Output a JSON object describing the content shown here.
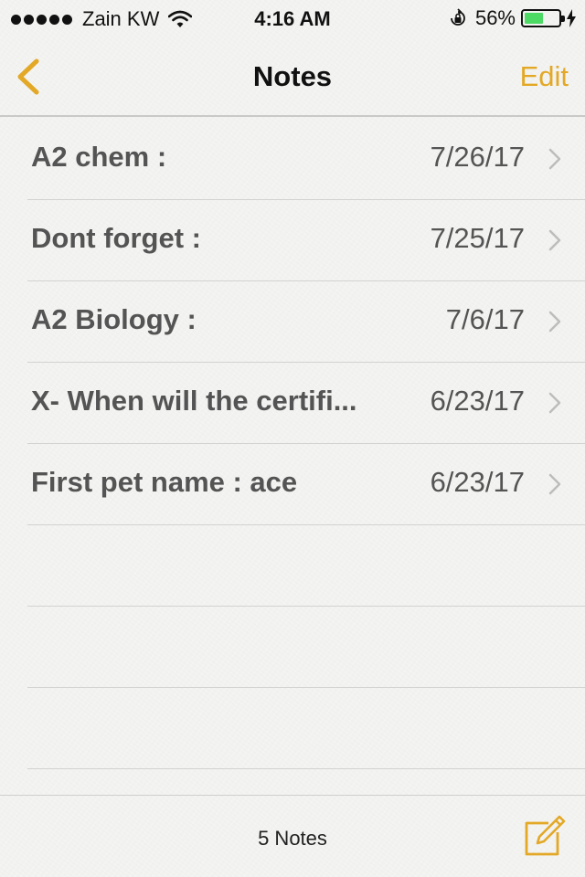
{
  "status_bar": {
    "carrier": "Zain KW",
    "time": "4:16 AM",
    "battery_percent": "56%",
    "battery_level": 0.56,
    "signal_dots": 5,
    "icons": [
      "wifi-icon",
      "rotation-lock-icon",
      "battery-icon",
      "charging-bolt-icon"
    ]
  },
  "nav": {
    "title": "Notes",
    "edit_label": "Edit",
    "back_icon": "chevron-left-icon"
  },
  "notes": [
    {
      "title": "A2 chem :",
      "date": "7/26/17"
    },
    {
      "title": "Dont forget :",
      "date": "7/25/17"
    },
    {
      "title": "A2 Biology :",
      "date": "7/6/17"
    },
    {
      "title": "X- When will the certifi...",
      "date": "6/23/17"
    },
    {
      "title": "First pet name : ace",
      "date": "6/23/17"
    }
  ],
  "toolbar": {
    "count_label": "5 Notes",
    "compose_icon": "compose-icon"
  },
  "colors": {
    "accent": "#e3a826",
    "text_gray": "#545454",
    "battery_green": "#4cd964",
    "background": "#f2f2f0"
  }
}
